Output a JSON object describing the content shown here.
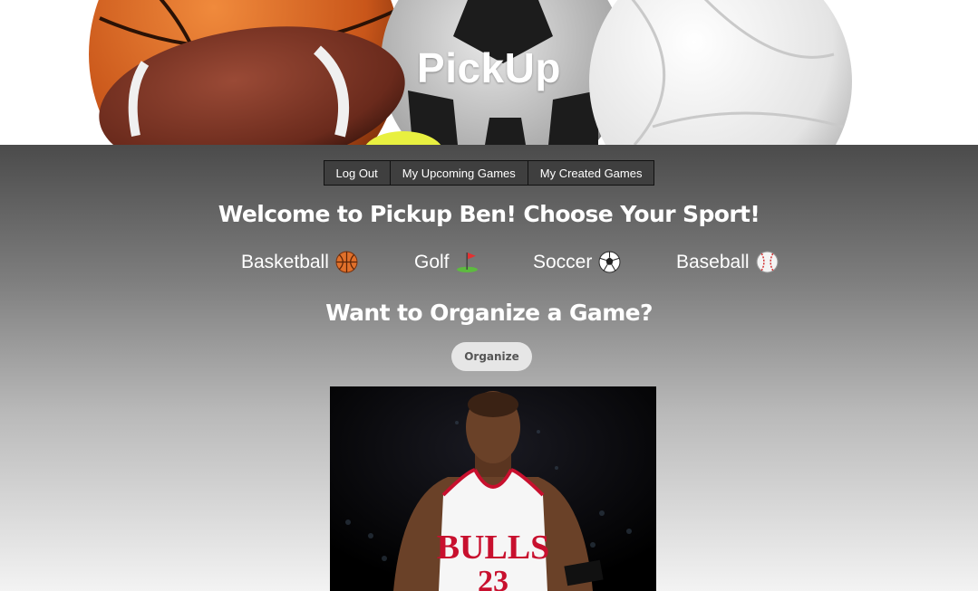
{
  "hero": {
    "title": "PickUp",
    "background_image": "sports-balls-banner"
  },
  "nav": {
    "logout_label": "Log Out",
    "upcoming_label": "My Upcoming Games",
    "created_label": "My Created Games"
  },
  "welcome": {
    "heading": "Welcome to Pickup Ben! Choose Your Sport!"
  },
  "sports": [
    {
      "label": "Basketball",
      "icon": "basketball-icon"
    },
    {
      "label": "Golf",
      "icon": "golf-flag-icon"
    },
    {
      "label": "Soccer",
      "icon": "soccer-ball-icon"
    },
    {
      "label": "Baseball",
      "icon": "baseball-icon"
    }
  ],
  "organize": {
    "heading": "Want to Organize a Game?",
    "button_label": "Organize"
  },
  "feature_image": {
    "jersey_text": "BULLS",
    "jersey_number": "23"
  },
  "colors": {
    "gradient_top": "#4b4b4b",
    "gradient_bottom": "#f3f3f3",
    "nav_button_bg": "#3f3f3f",
    "organize_button_bg": "#e6e6e6",
    "jersey_red": "#c8102e"
  }
}
